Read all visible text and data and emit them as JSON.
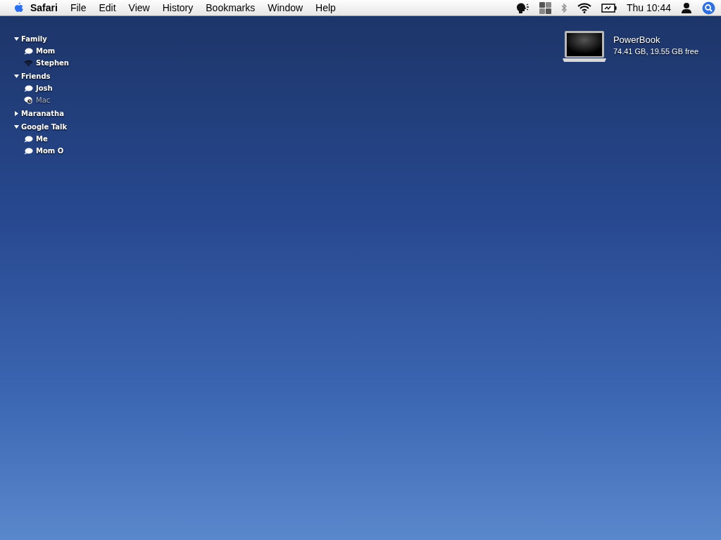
{
  "menu_bar": {
    "app_name": "Safari",
    "menus": [
      "File",
      "Edit",
      "View",
      "History",
      "Bookmarks",
      "Window",
      "Help"
    ],
    "clock": "Thu 10:44"
  },
  "buddy_list": [
    {
      "name": "Family",
      "expanded": true,
      "children": [
        {
          "name": "Mom",
          "kind": "available"
        },
        {
          "name": "Stephen",
          "kind": "mobile"
        }
      ]
    },
    {
      "name": "Friends",
      "expanded": true,
      "children": [
        {
          "name": "Josh",
          "kind": "available"
        },
        {
          "name": "Mac",
          "kind": "idle"
        }
      ]
    },
    {
      "name": "Maranatha",
      "expanded": false
    },
    {
      "name": "Google Talk",
      "expanded": true,
      "children": [
        {
          "name": "Me",
          "kind": "available"
        },
        {
          "name": "Mom O",
          "kind": "available"
        }
      ]
    }
  ],
  "desktop_drive": {
    "name": "PowerBook",
    "info": "74.41 GB, 19.55 GB free"
  }
}
